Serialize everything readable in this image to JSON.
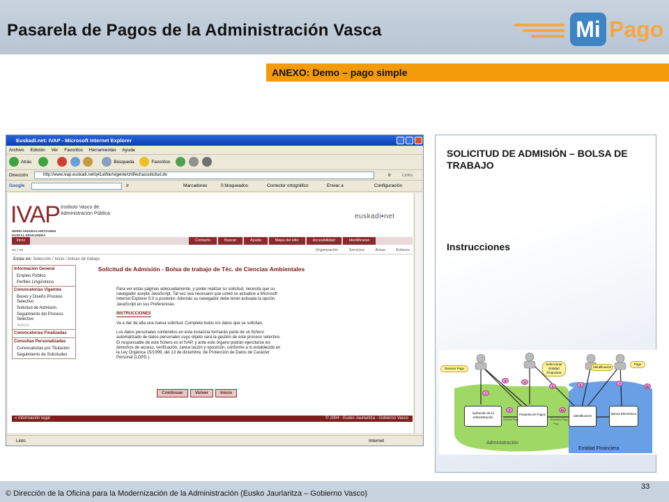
{
  "slide": {
    "title": "Pasarela de Pagos de la Administración Vasca",
    "logo": {
      "mi": "Mi",
      "pago": "Pago"
    },
    "annex": "ANEXO: Demo – pago simple",
    "footer": "© Dirección de la Oficina para la Modernización de la Administración (Eusko Jaurlaritza – Gobierno Vasco)",
    "page_number": "33"
  },
  "browser": {
    "window_title": "Euskadi.net: IVAP - Microsoft Internet Explorer",
    "menu": [
      "Archivo",
      "Edición",
      "Ver",
      "Favoritos",
      "Herramientas",
      "Ayuda"
    ],
    "toolbar": {
      "back": "Atrás",
      "search": "Búsqueda",
      "favorites": "Favoritos"
    },
    "address_label": "Dirección",
    "url": "http://www.ivap.euskadi.net/q41aWar/vigente/chlifechassolicitud.do",
    "go": "Ir",
    "links": "Links",
    "google_bar": {
      "label": "Google",
      "go": "Ir",
      "bookmarks": "Marcadores",
      "blocked": "0 bloqueados",
      "spell": "Corrector ortográfico",
      "send": "Enviar a",
      "config": "Configuración"
    },
    "status_left": "Listo",
    "status_right": "Internet"
  },
  "ivap": {
    "logo": "IVAP",
    "name_line1": "Instituto Vasco de",
    "name_line2": "Administración Pública",
    "sub_line1": "HERRI ARDURALARITZAREN",
    "sub_line2": "EUSKAL ERAKUNDEA",
    "euskadi_left": "euskadi",
    "euskadi_right": "net",
    "inicio": "Inicio",
    "topnav": [
      "Contacto",
      "Buscar",
      "Ayuda",
      "Mapa del sitio",
      "Accesibilidad",
      "Identificarse"
    ],
    "subnav_left": "eu | es",
    "subnav": [
      "Organización",
      "Servicios",
      "Áreas",
      "Enlaces"
    ],
    "breadcrumb_prefix": "Estás en:",
    "breadcrumb": "Selección / Inicio / bolsas de trabajo",
    "sidebar": [
      {
        "type": "head",
        "label": "Información General"
      },
      {
        "type": "item",
        "label": "Empleo Público"
      },
      {
        "type": "item",
        "label": "Perfiles Lingüísticos"
      },
      {
        "type": "head",
        "label": "Convocatorias Vigentes"
      },
      {
        "type": "item",
        "label": "Bases y Diseño Proceso Selectivo"
      },
      {
        "type": "item",
        "label": "Solicitud de Admisión"
      },
      {
        "type": "item",
        "label": "Seguimiento del Proceso Selectivo"
      },
      {
        "type": "dim",
        "label": "Avisos"
      },
      {
        "type": "head",
        "label": "Convocatorias Finalizadas"
      },
      {
        "type": "head",
        "label": "Consultas Personalizadas"
      },
      {
        "type": "item",
        "label": "Convocatorias por Titulación"
      },
      {
        "type": "item",
        "label": "Seguimiento de Solicitudes"
      }
    ],
    "form_title": "Solicitud de Admisión - Bolsa de trabajo de Téc. de Ciencias Ambientales",
    "intro": "Para ver estas páginas adecuadamente, y poder realizar su solicitud, necesita que su navegador acepte JavaScript. Tal vez sea necesario que usted se actualice a Microsoft Internet Explorer 5.0 o posterior. Además su navegador debe tener activada la opción JavaScript en sus Preferencias.",
    "instructions_label": "INSTRUCCIONES",
    "instructions_text": "Va a dar de alta una nueva solicitud. Complete todos los datos que se solicitan.",
    "privacy_text": "Los datos personales contenidos en esta instancia formarán parte de un fichero automatizado de datos personales cuyo objeto será la gestión de este proceso selectivo. El responsable de este fichero es el IVAP, y ante este órgano podrán ejercitarse los derechos de acceso, verificación, cance lación y oposición, conforme a lo establecido en la Ley Orgánica 15/1999, del 13 de diciembre, de Protección de Datos de Carácter Personal (LOPD ).",
    "buttons": [
      "Continuar",
      "Volver",
      "Inicio"
    ],
    "footer_left": "» Información legal",
    "footer_right": "© 2004 - Eusko Jaurlaritza - Gobierno Vasco"
  },
  "panel": {
    "heading": "SOLICITUD DE ADMISIÓN – BOLSA DE TRABAJO",
    "instructions": "Instrucciones"
  },
  "diagram": {
    "tags": [
      "Generar Pago",
      "Seleccionar Entidad Financiera",
      "Identificación",
      "Pago"
    ],
    "nodes": [
      "Aplicación de la Administración",
      "Pasarela de Pagos",
      "Identificación",
      "Banca Electrónica"
    ],
    "numbers": [
      "1",
      "2",
      "3",
      "4",
      "5",
      "6",
      "7",
      "8a",
      "8b"
    ],
    "flow_labels": [
      "Generar Pago",
      "Resultado Pago",
      "Pago"
    ],
    "regions": [
      "Administración",
      "Entidad Financiera"
    ],
    "colors": {
      "admin": "#8fd14a",
      "bank": "#4f8fe0"
    }
  }
}
